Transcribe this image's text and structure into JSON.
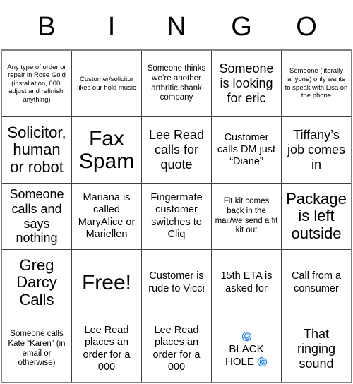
{
  "header": {
    "letters": [
      "B",
      "I",
      "N",
      "G",
      "O"
    ]
  },
  "colors": {
    "spiral_blue": "#1f7fe8",
    "grid_border": "#404040",
    "outer_border": "#808080",
    "text": "#000000",
    "background": "#ffffff"
  },
  "grid": {
    "rows": [
      [
        {
          "text": "Any type of order or repair in Rose Gold (installation, 000, adjust and refinish, anything)",
          "size": "fs-xs"
        },
        {
          "text": "Customer/solicitor likes our hold music",
          "size": "fs-xs"
        },
        {
          "text": "Someone thinks we’re another arthritic shank company",
          "size": "fs-sm"
        },
        {
          "text": "Someone is looking for eric",
          "size": "fs-lg"
        },
        {
          "text": "Someone (literally anyone) only wants to speak with Lisa on the phone",
          "size": "fs-xs"
        }
      ],
      [
        {
          "text": "Solicitor, human or robot",
          "size": "fs-xl"
        },
        {
          "text": "Fax Spam",
          "size": "fs-free"
        },
        {
          "text": "Lee Read calls for quote",
          "size": "fs-lg"
        },
        {
          "text": "Customer calls DM just “Diane”",
          "size": "fs-md"
        },
        {
          "text": "Tiffany’s job comes in",
          "size": "fs-lg"
        }
      ],
      [
        {
          "text": "Someone calls and says nothing",
          "size": "fs-lg"
        },
        {
          "text": "Mariana is called MaryAlice or Mariellen",
          "size": "fs-md"
        },
        {
          "text": "Fingermate customer switches to Cliq",
          "size": "fs-md"
        },
        {
          "text": "Fit kit comes back in the mail/we send a fit kit out",
          "size": "fs-sm"
        },
        {
          "text": "Package is left outside",
          "size": "fs-xl"
        }
      ],
      [
        {
          "text": "Greg Darcy Calls",
          "size": "fs-xl"
        },
        {
          "text": "Free!",
          "size": "fs-free"
        },
        {
          "text": "Customer is rude to Vicci",
          "size": "fs-md"
        },
        {
          "text": "15th ETA is asked for",
          "size": "fs-md"
        },
        {
          "text": "Call from a consumer",
          "size": "fs-md"
        }
      ],
      [
        {
          "text": "Someone calls Kate “Karen” (in email or otherwise)",
          "size": "fs-sm"
        },
        {
          "text": "Lee Read places an order for a 000",
          "size": "fs-md"
        },
        {
          "text": "Lee Read places an order for a 000",
          "size": "fs-md"
        },
        {
          "text": "BLACK HOLE",
          "size": "fs-md",
          "special": "black-hole"
        },
        {
          "text": "That ringing sound",
          "size": "fs-lg"
        }
      ]
    ],
    "black_hole_cell": {
      "line1": "BLACK",
      "line2": "HOLE",
      "icon_name": "cyclone-spiral-icon"
    }
  }
}
